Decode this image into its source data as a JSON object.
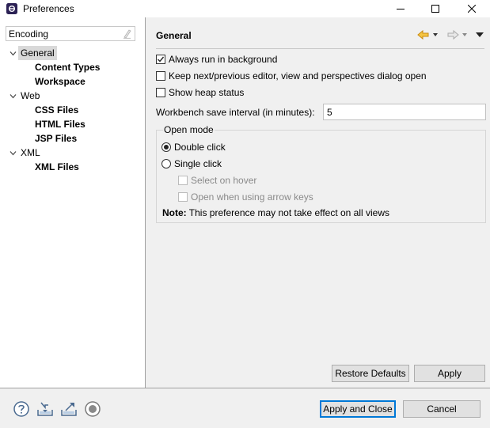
{
  "window": {
    "title": "Preferences"
  },
  "filter": {
    "value": "Encoding"
  },
  "tree": {
    "items": [
      {
        "label": "General",
        "expanded": true,
        "selected": true
      },
      {
        "label": "Content Types"
      },
      {
        "label": "Workspace"
      },
      {
        "label": "Web",
        "expanded": true
      },
      {
        "label": "CSS Files"
      },
      {
        "label": "HTML Files"
      },
      {
        "label": "JSP Files"
      },
      {
        "label": "XML",
        "expanded": true
      },
      {
        "label": "XML Files"
      }
    ]
  },
  "page": {
    "title": "General",
    "options": {
      "always_run_background": {
        "label": "Always run in background",
        "checked": true
      },
      "keep_next_prev": {
        "label": "Keep next/previous editor, view and perspectives dialog open",
        "checked": false
      },
      "show_heap": {
        "label": "Show heap status",
        "checked": false
      }
    },
    "save_interval": {
      "label": "Workbench save interval (in minutes):",
      "value": "5"
    },
    "open_mode": {
      "title": "Open mode",
      "double_click": {
        "label": "Double click",
        "checked": true
      },
      "single_click": {
        "label": "Single click",
        "checked": false
      },
      "select_on_hover": {
        "label": "Select on hover",
        "enabled": false
      },
      "open_arrow_keys": {
        "label": "Open when using arrow keys",
        "enabled": false
      },
      "note_label": "Note:",
      "note_text": " This preference may not take effect on all views"
    }
  },
  "buttons": {
    "restore_defaults": "Restore Defaults",
    "apply": "Apply",
    "apply_and_close": "Apply and Close",
    "cancel": "Cancel"
  },
  "footer": {
    "icons": [
      "help-icon",
      "import-icon",
      "export-icon",
      "record-icon"
    ]
  },
  "colors": {
    "default_button_border": "#0078d7",
    "nav_back_arrow": "#e0a020"
  }
}
